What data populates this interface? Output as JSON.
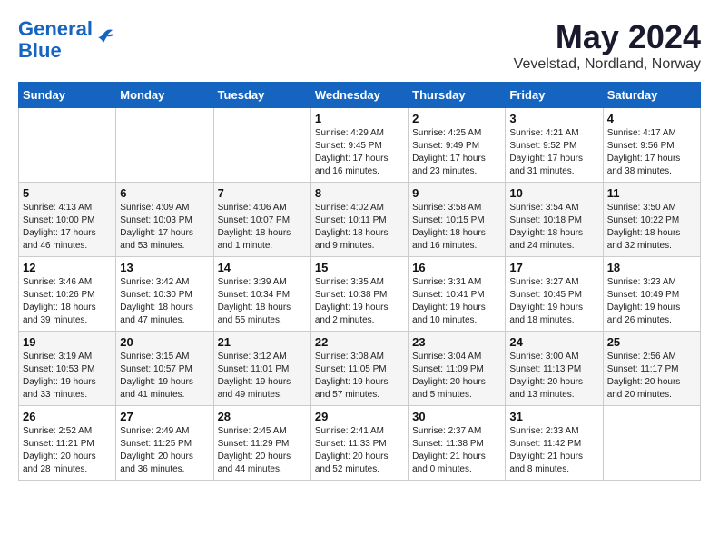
{
  "header": {
    "logo_line1": "General",
    "logo_line2": "Blue",
    "title": "May 2024",
    "subtitle": "Vevelstad, Nordland, Norway"
  },
  "days_of_week": [
    "Sunday",
    "Monday",
    "Tuesday",
    "Wednesday",
    "Thursday",
    "Friday",
    "Saturday"
  ],
  "weeks": [
    [
      {
        "day": "",
        "info": ""
      },
      {
        "day": "",
        "info": ""
      },
      {
        "day": "",
        "info": ""
      },
      {
        "day": "1",
        "info": "Sunrise: 4:29 AM\nSunset: 9:45 PM\nDaylight: 17 hours\nand 16 minutes."
      },
      {
        "day": "2",
        "info": "Sunrise: 4:25 AM\nSunset: 9:49 PM\nDaylight: 17 hours\nand 23 minutes."
      },
      {
        "day": "3",
        "info": "Sunrise: 4:21 AM\nSunset: 9:52 PM\nDaylight: 17 hours\nand 31 minutes."
      },
      {
        "day": "4",
        "info": "Sunrise: 4:17 AM\nSunset: 9:56 PM\nDaylight: 17 hours\nand 38 minutes."
      }
    ],
    [
      {
        "day": "5",
        "info": "Sunrise: 4:13 AM\nSunset: 10:00 PM\nDaylight: 17 hours\nand 46 minutes."
      },
      {
        "day": "6",
        "info": "Sunrise: 4:09 AM\nSunset: 10:03 PM\nDaylight: 17 hours\nand 53 minutes."
      },
      {
        "day": "7",
        "info": "Sunrise: 4:06 AM\nSunset: 10:07 PM\nDaylight: 18 hours\nand 1 minute."
      },
      {
        "day": "8",
        "info": "Sunrise: 4:02 AM\nSunset: 10:11 PM\nDaylight: 18 hours\nand 9 minutes."
      },
      {
        "day": "9",
        "info": "Sunrise: 3:58 AM\nSunset: 10:15 PM\nDaylight: 18 hours\nand 16 minutes."
      },
      {
        "day": "10",
        "info": "Sunrise: 3:54 AM\nSunset: 10:18 PM\nDaylight: 18 hours\nand 24 minutes."
      },
      {
        "day": "11",
        "info": "Sunrise: 3:50 AM\nSunset: 10:22 PM\nDaylight: 18 hours\nand 32 minutes."
      }
    ],
    [
      {
        "day": "12",
        "info": "Sunrise: 3:46 AM\nSunset: 10:26 PM\nDaylight: 18 hours\nand 39 minutes."
      },
      {
        "day": "13",
        "info": "Sunrise: 3:42 AM\nSunset: 10:30 PM\nDaylight: 18 hours\nand 47 minutes."
      },
      {
        "day": "14",
        "info": "Sunrise: 3:39 AM\nSunset: 10:34 PM\nDaylight: 18 hours\nand 55 minutes."
      },
      {
        "day": "15",
        "info": "Sunrise: 3:35 AM\nSunset: 10:38 PM\nDaylight: 19 hours\nand 2 minutes."
      },
      {
        "day": "16",
        "info": "Sunrise: 3:31 AM\nSunset: 10:41 PM\nDaylight: 19 hours\nand 10 minutes."
      },
      {
        "day": "17",
        "info": "Sunrise: 3:27 AM\nSunset: 10:45 PM\nDaylight: 19 hours\nand 18 minutes."
      },
      {
        "day": "18",
        "info": "Sunrise: 3:23 AM\nSunset: 10:49 PM\nDaylight: 19 hours\nand 26 minutes."
      }
    ],
    [
      {
        "day": "19",
        "info": "Sunrise: 3:19 AM\nSunset: 10:53 PM\nDaylight: 19 hours\nand 33 minutes."
      },
      {
        "day": "20",
        "info": "Sunrise: 3:15 AM\nSunset: 10:57 PM\nDaylight: 19 hours\nand 41 minutes."
      },
      {
        "day": "21",
        "info": "Sunrise: 3:12 AM\nSunset: 11:01 PM\nDaylight: 19 hours\nand 49 minutes."
      },
      {
        "day": "22",
        "info": "Sunrise: 3:08 AM\nSunset: 11:05 PM\nDaylight: 19 hours\nand 57 minutes."
      },
      {
        "day": "23",
        "info": "Sunrise: 3:04 AM\nSunset: 11:09 PM\nDaylight: 20 hours\nand 5 minutes."
      },
      {
        "day": "24",
        "info": "Sunrise: 3:00 AM\nSunset: 11:13 PM\nDaylight: 20 hours\nand 13 minutes."
      },
      {
        "day": "25",
        "info": "Sunrise: 2:56 AM\nSunset: 11:17 PM\nDaylight: 20 hours\nand 20 minutes."
      }
    ],
    [
      {
        "day": "26",
        "info": "Sunrise: 2:52 AM\nSunset: 11:21 PM\nDaylight: 20 hours\nand 28 minutes."
      },
      {
        "day": "27",
        "info": "Sunrise: 2:49 AM\nSunset: 11:25 PM\nDaylight: 20 hours\nand 36 minutes."
      },
      {
        "day": "28",
        "info": "Sunrise: 2:45 AM\nSunset: 11:29 PM\nDaylight: 20 hours\nand 44 minutes."
      },
      {
        "day": "29",
        "info": "Sunrise: 2:41 AM\nSunset: 11:33 PM\nDaylight: 20 hours\nand 52 minutes."
      },
      {
        "day": "30",
        "info": "Sunrise: 2:37 AM\nSunset: 11:38 PM\nDaylight: 21 hours\nand 0 minutes."
      },
      {
        "day": "31",
        "info": "Sunrise: 2:33 AM\nSunset: 11:42 PM\nDaylight: 21 hours\nand 8 minutes."
      },
      {
        "day": "",
        "info": ""
      }
    ]
  ]
}
